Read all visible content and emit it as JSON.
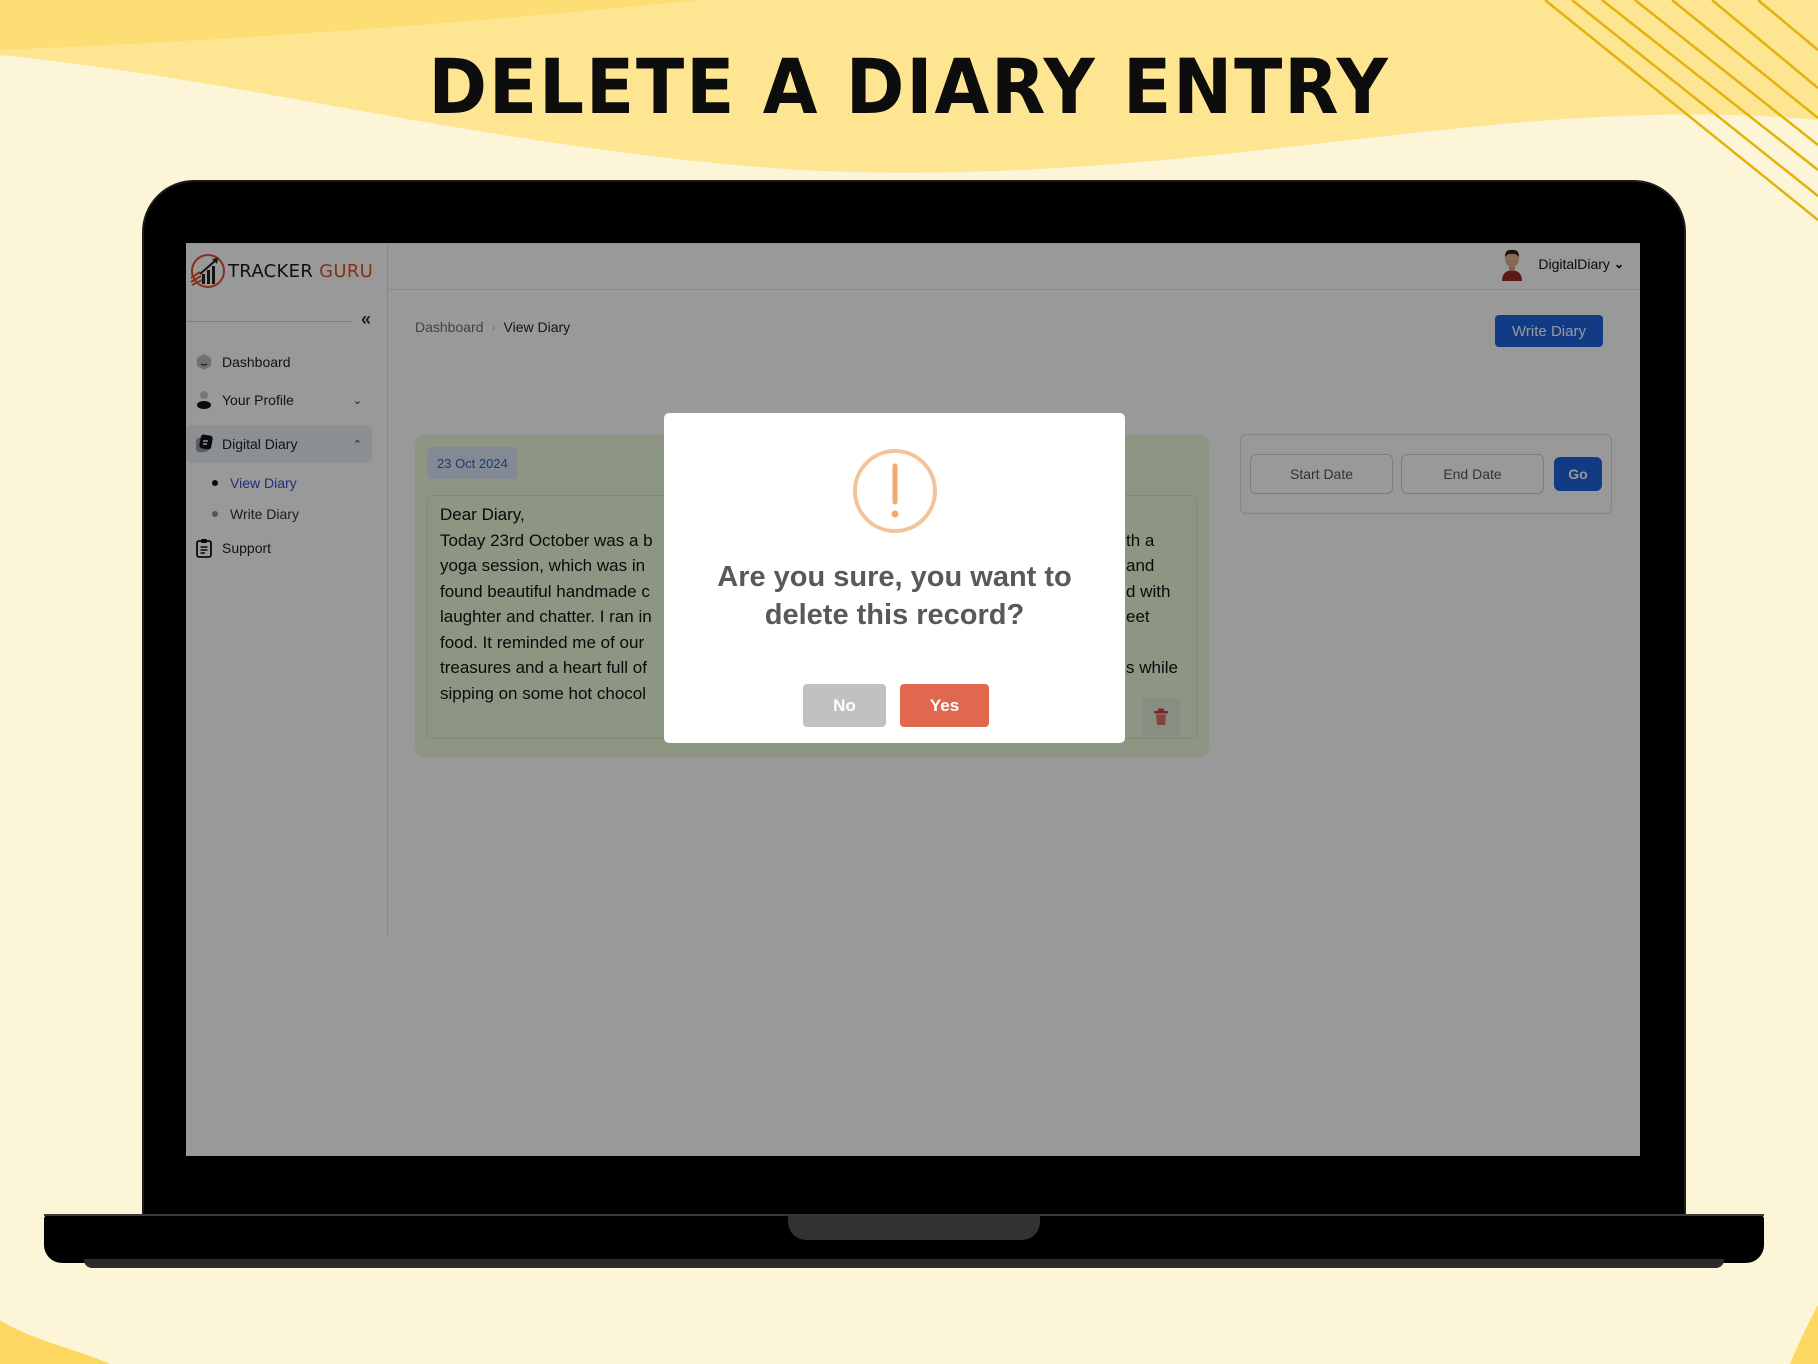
{
  "banner": {
    "headline": "DELETE A DIARY ENTRY"
  },
  "colors": {
    "background": "#fdf5d8",
    "accent_yellow": "#fddc6c",
    "stripe_gold": "#e2b30a",
    "primary_blue": "#1d63dc",
    "danger": "#e0684f",
    "warning_icon": "#f3a96a",
    "card_green": "#eafadb"
  },
  "app": {
    "logo": {
      "word1": "TRACKER",
      "word2": "GURU"
    },
    "collapse_icon": "«",
    "sidebar": {
      "items": [
        {
          "label": "Dashboard",
          "icon": "dashboard-icon"
        },
        {
          "label": "Your Profile",
          "icon": "user-icon",
          "chevron": "⌄"
        },
        {
          "label": "Digital Diary",
          "icon": "diary-icon",
          "chevron": "⌃",
          "active": true,
          "children": [
            {
              "label": "View Diary",
              "active": true
            },
            {
              "label": "Write Diary"
            }
          ]
        },
        {
          "label": "Support",
          "icon": "clipboard-icon"
        }
      ]
    },
    "topbar": {
      "user_name": "DigitalDiary",
      "user_chevron": "⌄"
    },
    "breadcrumb": {
      "root": "Dashboard",
      "separator": "›",
      "current": "View Diary"
    },
    "write_button": "Write Diary",
    "entry": {
      "date": "23 Oct 2024",
      "lines": [
        {
          "left": "Dear Diary,",
          "right": ""
        },
        {
          "left": "Today 23rd October was a b",
          "right": "th a"
        },
        {
          "left": "yoga session, which was in",
          "right": "and"
        },
        {
          "left": "found beautiful handmade c",
          "right": "d with"
        },
        {
          "left": "laughter and chatter. I ran in",
          "right": "eet"
        },
        {
          "left": "food. It reminded me of our",
          "right": ""
        },
        {
          "left": "treasures and a heart full of",
          "right": "s while"
        },
        {
          "left": "sipping on some hot chocol",
          "right": ""
        }
      ]
    },
    "filter": {
      "start_placeholder": "Start Date",
      "end_placeholder": "End Date",
      "go_label": "Go"
    },
    "modal": {
      "icon": "warning-icon",
      "title_line1": "Are you sure, you want to",
      "title_line2": "delete this record?",
      "no_label": "No",
      "yes_label": "Yes"
    }
  }
}
